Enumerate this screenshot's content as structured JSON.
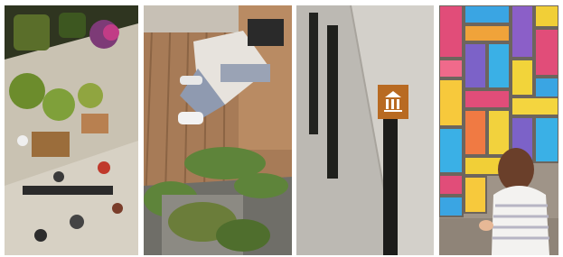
{
  "collage": {
    "panels": [
      {
        "name": "aerial-plaza-with-planters-and-seating",
        "dominant_colors": [
          "#3c3a2a",
          "#8a6a3c",
          "#6a8c3a",
          "#c8c2b4"
        ]
      },
      {
        "name": "person-on-wooden-deck-with-ferns",
        "dominant_colors": [
          "#a67b58",
          "#e6e2dc",
          "#5b7d3b",
          "#7a7a78"
        ]
      },
      {
        "name": "street-bollards-with-sign",
        "dominant_colors": [
          "#bdb9b4",
          "#2a2a28",
          "#b86b25",
          "#d2cec8"
        ]
      },
      {
        "name": "child-chalk-drawing-on-brick-pavement",
        "dominant_colors": [
          "#e84b7a",
          "#f0d43a",
          "#3aa7e6",
          "#7c62c8"
        ]
      }
    ]
  }
}
